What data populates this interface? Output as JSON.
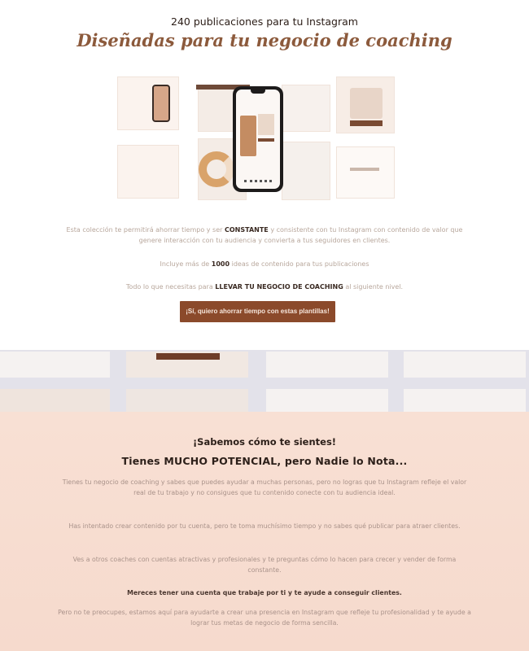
{
  "hero": {
    "kicker": "240 publicaciones para tu Instagram",
    "title": "Diseñadas para tu negocio de coaching",
    "p1_pre": "Esta colección te permitirá ahorrar tiempo y ser",
    "p1_strong": "CONSTANTE",
    "p1_post": "y consistente con tu Instagram con contenido de valor que genere interacción con tu audiencia y convierta a tus seguidores en clientes.",
    "p2_pre": "Incluye más de",
    "p2_strong": "1000",
    "p2_post": "ideas de contenido para tus publicaciones",
    "p3_pre": "Todo lo que necesitas para",
    "p3_strong": "LLEVAR TU NEGOCIO DE COACHING",
    "p3_post": "al siguiente nivel.",
    "cta": "¡Sí, quiero ahorrar tiempo con estas plantillas!"
  },
  "pain": {
    "kicker": "¡Sabemos cómo te sientes!",
    "title": "Tienes MUCHO POTENCIAL, pero Nadie lo Nota...",
    "b1": "Tienes tu negocio de coaching y sabes que puedes ayudar a muchas personas, pero no logras que tu Instagram refleje el valor real de tu trabajo y no consigues que tu contenido conecte con tu audiencia ideal.",
    "b2": "Has intentado crear contenido por tu cuenta, pero te toma muchísimo tiempo y no sabes qué publicar para atraer clientes.",
    "b3": "Ves a otros coaches con cuentas atractivas y profesionales y te preguntas cómo lo hacen para crecer y vender de forma constante.",
    "b4": "Mereces tener una cuenta que trabaje por ti y te ayude a conseguir clientes.",
    "b5": "Pero no te preocupes, estamos aquí para ayudarte a crear una presencia en Instagram que refleje tu profesionalidad y te ayude a lograr tus metas de negocio de forma sencilla."
  },
  "icons": {
    "phone": "phone-mockup-icon"
  },
  "colors": {
    "brand": "#8b4a2b",
    "title": "#8c5a3c",
    "pain_bg": "#f8e0d4"
  }
}
